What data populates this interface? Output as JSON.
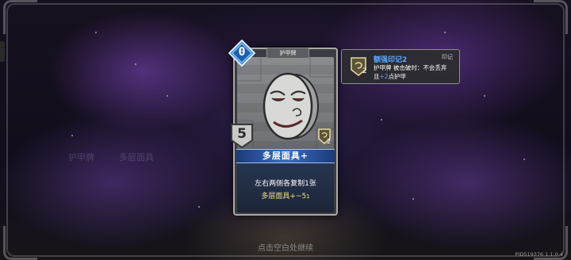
{
  "card": {
    "type_label": "护甲牌",
    "cost": "0",
    "armor": "5",
    "mark_count": "2",
    "name": "多层面具+",
    "desc_line1": "左右两侧各复制1张",
    "desc_line2_main": "多层面具+~5",
    "desc_line2_sub": "1"
  },
  "tooltip": {
    "title": "额强印记2",
    "tag": "印记",
    "icon_count": "2",
    "line1": "护甲牌 被击破时：不会丢弃",
    "line2_a": "且",
    "line2_hl": "+2",
    "line2_b": "点护甲"
  },
  "background": {
    "ghost_text_1": "护甲牌",
    "ghost_text_2": "多层面具"
  },
  "footer": {
    "continue_hint": "点击空白处继续",
    "version": "PID519376  1.1.0.4"
  },
  "colors": {
    "cost_blue": "#3a87d9",
    "armor_gray": "#c9c9c9",
    "name_banner": "#3a6ec4",
    "highlight_blue": "#5aa9ff",
    "desc_gold": "#f2e38a"
  },
  "icons": [
    "cost-gem-icon",
    "armor-shield-icon",
    "mark-shield-icon",
    "mask-art"
  ]
}
